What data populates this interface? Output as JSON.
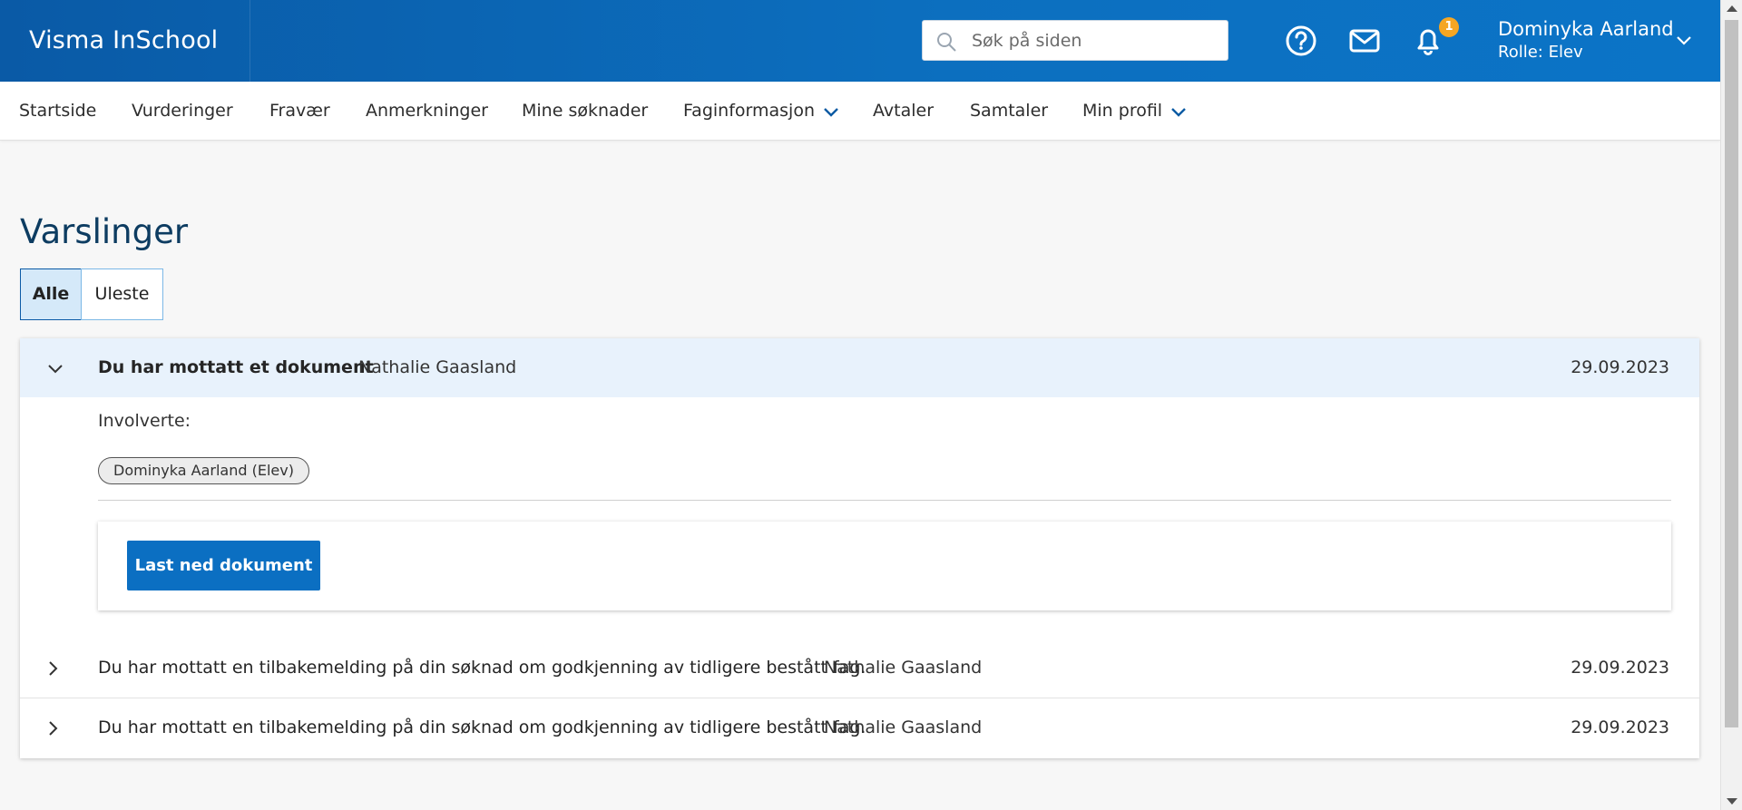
{
  "header": {
    "brand": "Visma InSchool",
    "search_placeholder": "Søk på siden",
    "notification_count": "1",
    "user_name": "Dominyka Aarland",
    "user_role": "Rolle: Elev"
  },
  "nav": {
    "items": [
      "Startside",
      "Vurderinger",
      "Fravær",
      "Anmerkninger",
      "Mine søknader",
      "Faginformasjon",
      "Avtaler",
      "Samtaler",
      "Min profil"
    ]
  },
  "page": {
    "title": "Varslinger",
    "filters": [
      "Alle",
      "Uleste"
    ]
  },
  "notifications": [
    {
      "title": "Du har mottatt et dokument",
      "from": "Nathalie Gaasland",
      "date": "29.09.2023",
      "involved_label": "Involverte:",
      "involved": "Dominyka Aarland (Elev)",
      "action": "Last ned dokument"
    },
    {
      "title": "Du har mottatt en tilbakemelding på din søknad om godkjenning av tidligere bestått fag.",
      "from": "Nathalie Gaasland",
      "date": "29.09.2023"
    },
    {
      "title": "Du har mottatt en tilbakemelding på din søknad om godkjenning av tidligere bestått fag.",
      "from": "Nathalie Gaasland",
      "date": "29.09.2023"
    }
  ],
  "colors": {
    "header_blue": "#0b6fc2",
    "accent_blue": "#0b6fc2",
    "badge_orange": "#f5a623",
    "active_row": "#e8f2fc"
  },
  "icons": [
    "search-icon",
    "help-icon",
    "mail-icon",
    "bell-icon",
    "chevron-down-icon",
    "chevron-right-icon"
  ]
}
